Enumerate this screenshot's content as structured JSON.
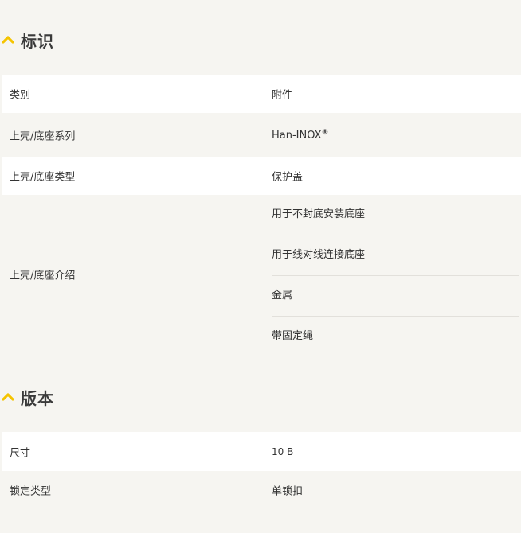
{
  "sections": {
    "identification": {
      "title": "标识",
      "rows": {
        "category": {
          "label": "类别",
          "value": "附件"
        },
        "series": {
          "label": "上壳/底座系列",
          "value": "Han-INOX",
          "value_sup": "®"
        },
        "type": {
          "label": "上壳/底座类型",
          "value": "保护盖"
        },
        "intro": {
          "label": "上壳/底座介绍",
          "values": [
            "用于不封底安装底座",
            "用于线对线连接底座",
            "金属",
            "带固定绳"
          ]
        }
      }
    },
    "version": {
      "title": "版本",
      "rows": {
        "size": {
          "label": "尺寸",
          "value": "10 B"
        },
        "lock": {
          "label": "锁定类型",
          "value": "单锁扣"
        }
      }
    }
  },
  "colors": {
    "accent": "#f5c400",
    "row_white": "#ffffff",
    "row_grey": "#f6f5f1"
  },
  "icons": {
    "collapse": "chevron-up-icon"
  }
}
